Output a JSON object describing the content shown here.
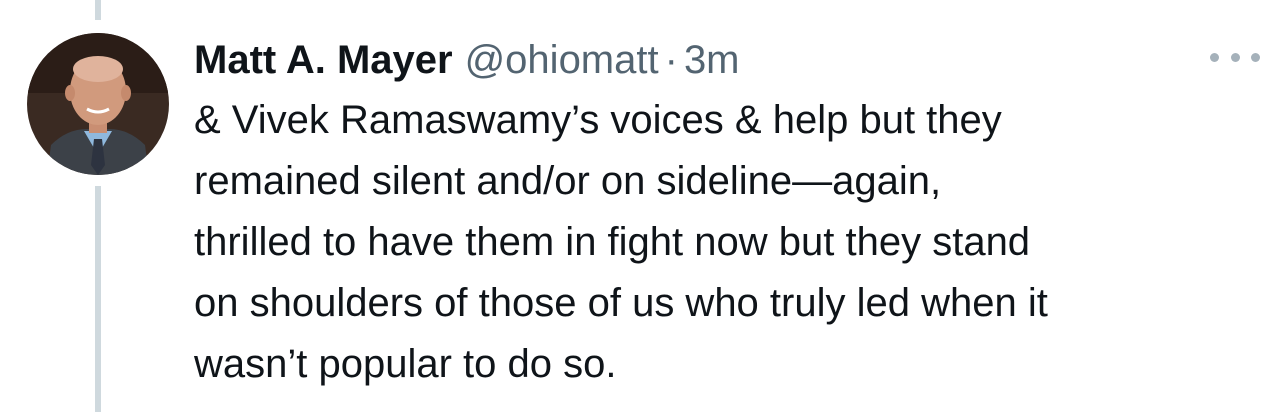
{
  "tweet": {
    "author_name": "Matt A. Mayer",
    "handle": "@ohiomatt",
    "separator": "·",
    "timestamp": "3m",
    "text_lines": [
      "& Vivek Ramaswamy’s voices & help but they",
      "remained silent and/or on sideline—again,",
      "thrilled to have them in fight now but they stand",
      "on shoulders of those of us who truly led when it",
      "wasn’t popular to do so."
    ]
  },
  "icons": {
    "more": "more-horizontal-icon"
  },
  "colors": {
    "text_primary": "#0f1419",
    "text_secondary": "#536471",
    "thread_line": "#cfd9de",
    "more_dots": "#a5b1ba"
  }
}
